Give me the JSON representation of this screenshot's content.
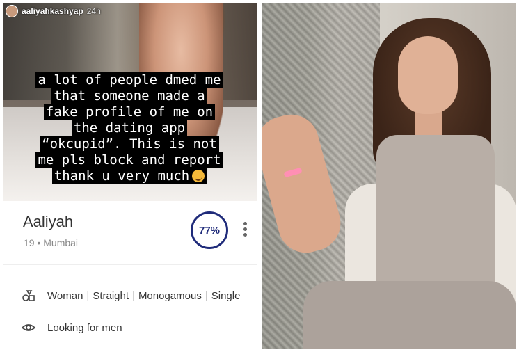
{
  "story": {
    "username": "aaliyahkashyap",
    "time": "24h",
    "lines": [
      "a lot of people dmed me",
      "that someone made a",
      "fake profile of me on",
      "the dating app",
      "“okcupid”. This is not",
      "me pls block and report",
      "thank u very much"
    ],
    "emoji": "smiling-face-with-hearts"
  },
  "profile": {
    "name": "Aaliyah",
    "meta": "19 • Mumbai",
    "match": "77%",
    "identity": [
      "Woman",
      "Straight",
      "Monogamous",
      "Single"
    ],
    "looking_for": "Looking for men"
  },
  "colors": {
    "match_ring": "#1f2b7a",
    "story_text_bg": "#000000",
    "story_text": "#ffffff"
  }
}
